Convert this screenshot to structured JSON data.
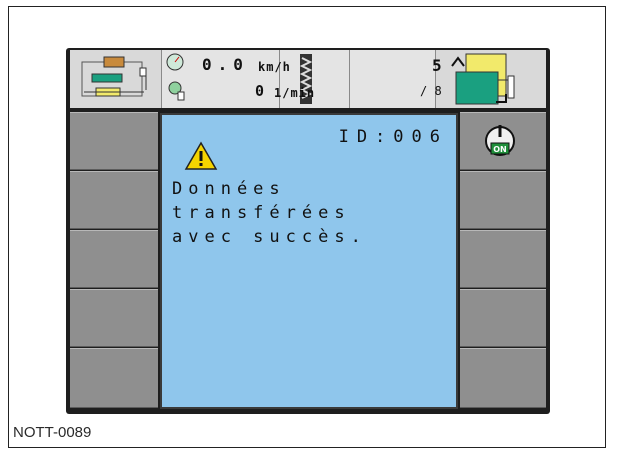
{
  "figure_label": "NOTT-0089",
  "status_bar": {
    "speed_value": "0.0",
    "speed_unit": "km/h",
    "rpm_value": "0",
    "rpm_unit": "1/min",
    "counter_value": "5",
    "counter_total": "/ 8"
  },
  "message": {
    "id_text": "ID:006",
    "lines": [
      "Données",
      "transférées",
      "avec succès."
    ],
    "warning_icon": "warning-icon"
  },
  "right_softkeys": {
    "power_badge": "ON",
    "power_icon": "power-on-icon"
  },
  "colors": {
    "dialog_background": "#8fc6ec",
    "softkey_grey": "#8f8f8f",
    "warning_yellow": "#f5d400",
    "accent_green": "#1aa080",
    "accent_yellow": "#f2ea6b"
  }
}
